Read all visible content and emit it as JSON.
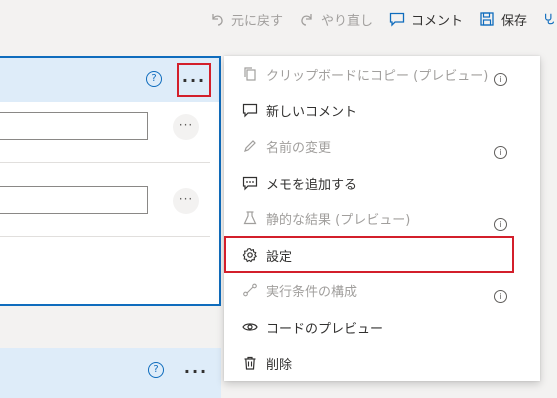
{
  "toolbar": {
    "undo_label": "元に戻す",
    "redo_label": "やり直し",
    "comment_label": "コメント",
    "save_label": "保存"
  },
  "card": {
    "help_glyph": "?",
    "more_glyph": "···",
    "row_more_glyph": "···"
  },
  "menu": {
    "items": [
      {
        "label": "クリップボードにコピー (プレビュー)",
        "icon": "copy-icon",
        "enabled": false,
        "info": true
      },
      {
        "label": "新しいコメント",
        "icon": "comment-icon",
        "enabled": true,
        "info": false
      },
      {
        "label": "名前の変更",
        "icon": "pencil-icon",
        "enabled": false,
        "info": true
      },
      {
        "label": "メモを追加する",
        "icon": "note-icon",
        "enabled": true,
        "info": false
      },
      {
        "label": "静的な結果 (プレビュー)",
        "icon": "flask-icon",
        "enabled": false,
        "info": true
      },
      {
        "label": "設定",
        "icon": "gear-icon",
        "enabled": true,
        "info": false,
        "highlighted": true
      },
      {
        "label": "実行条件の構成",
        "icon": "run-after-icon",
        "enabled": false,
        "info": true
      },
      {
        "label": "コードのプレビュー",
        "icon": "eye-icon",
        "enabled": true,
        "info": false
      },
      {
        "label": "削除",
        "icon": "trash-icon",
        "enabled": true,
        "info": false
      }
    ],
    "info_glyph": "i"
  },
  "colors": {
    "accent": "#0f6cbd",
    "highlight": "#d31f2b",
    "disabled_text": "#a19f9d",
    "card_header": "#deecf9"
  }
}
